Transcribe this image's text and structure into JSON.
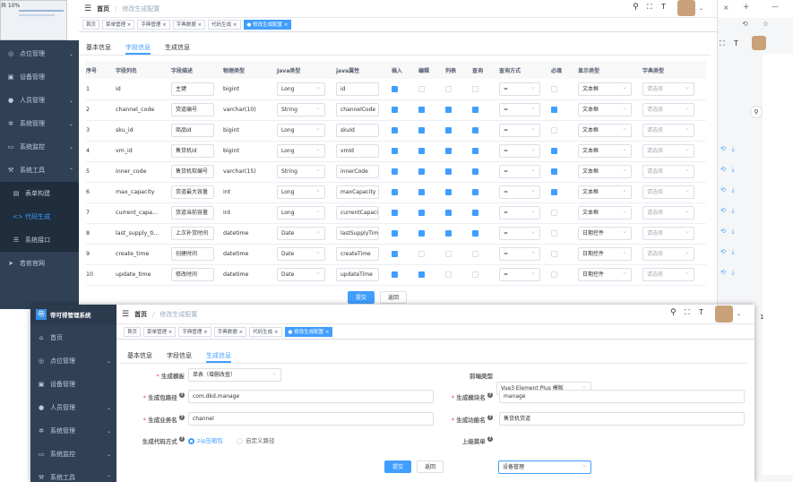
{
  "thumb": {
    "percent": "共 10%"
  },
  "back": {
    "sidebar": [
      "点位管理",
      "设备管理",
      "人员管理",
      "系统管理",
      "系统监控",
      "系统工具",
      "表单构建",
      "代码生成",
      "系统接口",
      "若依官网"
    ],
    "breadcrumb": {
      "home": "首页",
      "current": "修改生成配置"
    },
    "tags": [
      "首页",
      "菜单管理",
      "字典管理",
      "字典数据",
      "代码生成",
      "修改生成配置"
    ],
    "subtabs": [
      "基本信息",
      "字段信息",
      "生成信息"
    ],
    "columns": [
      "序号",
      "字段列名",
      "字段描述",
      "物理类型",
      "Java类型",
      "java属性",
      "插入",
      "编辑",
      "列表",
      "查询",
      "查询方式",
      "必填",
      "显示类型",
      "字典类型"
    ],
    "rows": [
      {
        "no": "1",
        "col": "id",
        "desc": "主键",
        "phys": "bigint",
        "jt": "Long",
        "jp": "id",
        "ins": true,
        "edit": false,
        "list": false,
        "query": false,
        "qm": "=",
        "req": false,
        "show": "文本框"
      },
      {
        "no": "2",
        "col": "channel_code",
        "desc": "货道编号",
        "phys": "varchar(10)",
        "jt": "String",
        "jp": "channelCode",
        "ins": true,
        "edit": true,
        "list": true,
        "query": true,
        "qm": "=",
        "req": true,
        "show": "文本框"
      },
      {
        "no": "3",
        "col": "sku_id",
        "desc": "商品Id",
        "phys": "bigint",
        "jt": "Long",
        "jp": "skuId",
        "ins": true,
        "edit": true,
        "list": true,
        "query": true,
        "qm": "=",
        "req": false,
        "show": "文本框"
      },
      {
        "no": "4",
        "col": "vm_id",
        "desc": "售货机Id",
        "phys": "bigint",
        "jt": "Long",
        "jp": "vmId",
        "ins": true,
        "edit": true,
        "list": true,
        "query": true,
        "qm": "=",
        "req": true,
        "show": "文本框"
      },
      {
        "no": "5",
        "col": "inner_code",
        "desc": "售货机软编号",
        "phys": "varchar(15)",
        "jt": "String",
        "jp": "innerCode",
        "ins": true,
        "edit": true,
        "list": true,
        "query": true,
        "qm": "=",
        "req": true,
        "show": "文本框"
      },
      {
        "no": "6",
        "col": "max_capacity",
        "desc": "货道最大容量",
        "phys": "int",
        "jt": "Long",
        "jp": "maxCapacity",
        "ins": true,
        "edit": true,
        "list": true,
        "query": true,
        "qm": "=",
        "req": true,
        "show": "文本框"
      },
      {
        "no": "7",
        "col": "current_capa...",
        "desc": "货道当前容量",
        "phys": "int",
        "jt": "Long",
        "jp": "currentCapacity",
        "ins": true,
        "edit": true,
        "list": true,
        "query": true,
        "qm": "=",
        "req": false,
        "show": "文本框"
      },
      {
        "no": "8",
        "col": "last_supply_ti...",
        "desc": "上次补货时间",
        "phys": "datetime",
        "jt": "Date",
        "jp": "lastSupplyTime",
        "ins": true,
        "edit": true,
        "list": true,
        "query": true,
        "qm": "=",
        "req": false,
        "show": "日期控件"
      },
      {
        "no": "9",
        "col": "create_time",
        "desc": "创建时间",
        "phys": "datetime",
        "jt": "Date",
        "jp": "createTime",
        "ins": true,
        "edit": false,
        "list": false,
        "query": false,
        "qm": "=",
        "req": false,
        "show": "日期控件"
      },
      {
        "no": "10",
        "col": "update_time",
        "desc": "修改时间",
        "phys": "datetime",
        "jt": "Date",
        "jp": "updateTime",
        "ins": true,
        "edit": true,
        "list": false,
        "query": false,
        "qm": "=",
        "req": false,
        "show": "日期控件"
      }
    ],
    "dict_placeholder": "请选择",
    "submit": "提交",
    "cancel": "返回"
  },
  "front": {
    "app_title": "帝可得管理系统",
    "sidebar": [
      "首页",
      "点位管理",
      "设备管理",
      "人员管理",
      "系统管理",
      "系统监控",
      "系统工具"
    ],
    "breadcrumb": {
      "home": "首页",
      "current": "修改生成配置"
    },
    "tags": [
      "首页",
      "菜单管理",
      "字典管理",
      "字典数据",
      "代码生成",
      "修改生成配置"
    ],
    "subtabs": [
      "基本信息",
      "字段信息",
      "生成信息"
    ],
    "form": {
      "tpl_label": "生成模板",
      "tpl_value": "单表（增删改查）",
      "front_label": "前端类型",
      "front_value": "Vue3 Element Plus 模版",
      "pkg_label": "生成包路径",
      "pkg_value": "com.dkd.manage",
      "mod_label": "生成模块名",
      "mod_value": "manage",
      "biz_label": "生成业务名",
      "biz_value": "channel",
      "fn_label": "生成功能名",
      "fn_value": "售货机货道",
      "way_label": "生成代码方式",
      "way_opt1": "zip压缩包",
      "way_opt2": "自定义路径",
      "menu_label": "上级菜单",
      "menu_value": "设备管理",
      "submit": "提交",
      "cancel": "返回"
    }
  },
  "colors": {
    "accent": "#409eff",
    "sidebar": "#304156"
  }
}
